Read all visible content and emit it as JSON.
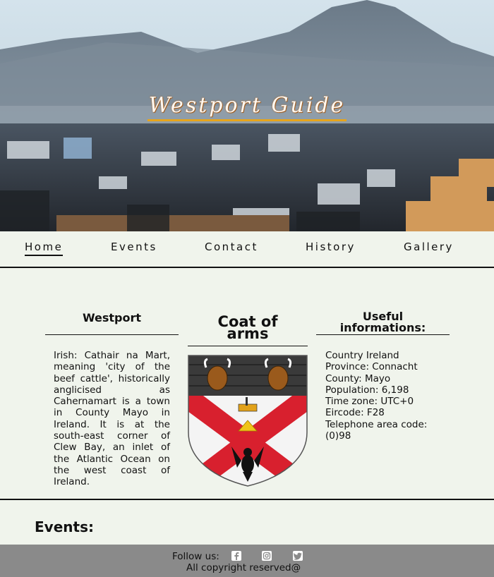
{
  "hero": {
    "title": "Westport Guide"
  },
  "nav": {
    "items": [
      {
        "label": "Home",
        "active": true
      },
      {
        "label": "Events",
        "active": false
      },
      {
        "label": "Contact",
        "active": false
      },
      {
        "label": "History",
        "active": false
      },
      {
        "label": "Gallery",
        "active": false
      }
    ]
  },
  "westport": {
    "title": "Westport",
    "text": "Irish: Cathair na Mart, meaning 'city of the beef cattle', historically anglicised as Cahernamart is a town in County Mayo in Ireland. It is at the south-east corner of Clew Bay, an inlet of the Atlantic Ocean on the west coast of Ireland."
  },
  "coat": {
    "title_line1": "Coat of",
    "title_line2": "arms",
    "image_icon": "coat-of-arms-image"
  },
  "info": {
    "title_line1": "Useful",
    "title_line2": "informations:",
    "lines": [
      "Country Ireland",
      "Province: Connacht",
      "County: Mayo",
      "Population: 6,198",
      "Time zone: UTC+0",
      "Eircode: F28",
      "Telephone area code:",
      "(0)98"
    ]
  },
  "events": {
    "title": "Events:"
  },
  "footer": {
    "follow_label": "Follow us:",
    "copyright": "All copyright reserved@",
    "social_icons": [
      "facebook-icon",
      "instagram-icon",
      "twitter-icon"
    ]
  },
  "colors": {
    "background": "#f0f4ec",
    "footer": "#8a8a8a",
    "title_underline": "#e6a41c",
    "shield_cross": "#d8202e"
  }
}
